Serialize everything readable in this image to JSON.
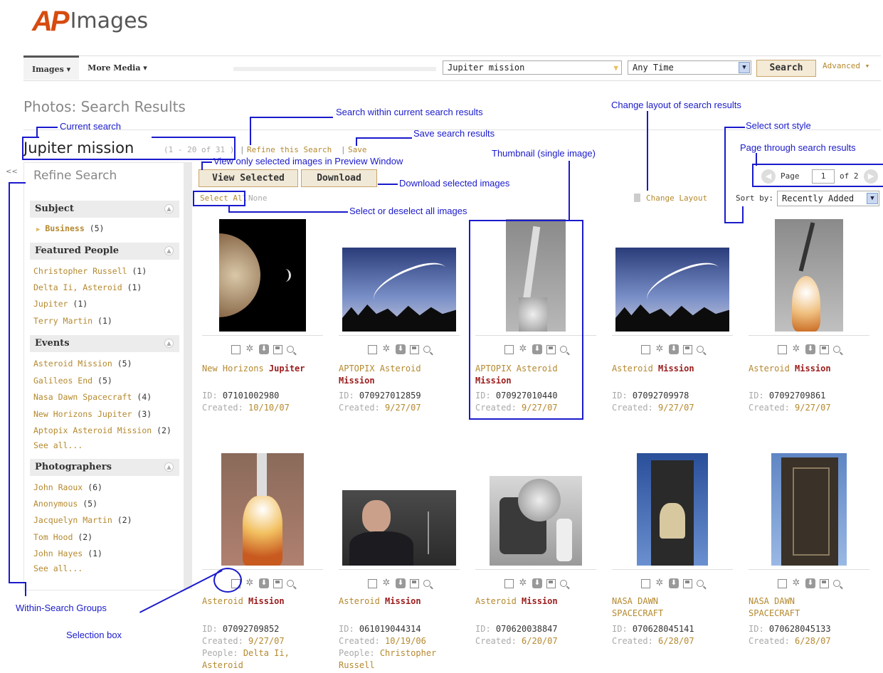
{
  "logo": {
    "ap": "AP",
    "images": "Images"
  },
  "nav": {
    "tabs": [
      "Images ▾",
      "More Media ▾"
    ],
    "search_value": "Jupiter mission",
    "time_value": "Any Time",
    "search_button": "Search",
    "advanced": "Advanced ▾"
  },
  "header": {
    "page_heading": "Photos: Search Results",
    "query": "Jupiter mission",
    "range": "(1 - 20 of 31 )",
    "refine_link": "Refine this Search",
    "save_link": "Save"
  },
  "sidebar": {
    "title": "Refine Search",
    "groups": [
      {
        "title": "Subject",
        "items": [
          {
            "label": "Business",
            "count": "(5)"
          }
        ]
      },
      {
        "title": "Featured People",
        "items": [
          {
            "label": "Christopher Russell",
            "count": "(1)"
          },
          {
            "label": "Delta Ii, Asteroid",
            "count": "(1)"
          },
          {
            "label": "Jupiter",
            "count": "(1)"
          },
          {
            "label": "Terry Martin",
            "count": "(1)"
          }
        ]
      },
      {
        "title": "Events",
        "items": [
          {
            "label": "Asteroid Mission",
            "count": "(5)"
          },
          {
            "label": "Galileos End",
            "count": "(5)"
          },
          {
            "label": "Nasa Dawn Spacecraft",
            "count": "(4)"
          },
          {
            "label": "New Horizons Jupiter",
            "count": "(3)"
          },
          {
            "label": "Aptopix Asteroid Mission",
            "count": "(2)"
          }
        ],
        "see_all": "See all..."
      },
      {
        "title": "Photographers",
        "items": [
          {
            "label": "John Raoux",
            "count": "(6)"
          },
          {
            "label": "Anonymous",
            "count": "(5)"
          },
          {
            "label": "Jacquelyn Martin",
            "count": "(2)"
          },
          {
            "label": "Tom Hood",
            "count": "(2)"
          },
          {
            "label": "John Hayes",
            "count": "(1)"
          }
        ],
        "see_all": "See all..."
      }
    ]
  },
  "toolbar": {
    "view_selected": "View Selected",
    "download": "Download",
    "select_all": "Select All",
    "none": "None",
    "change_layout": "Change Layout",
    "sort_label": "Sort by:",
    "sort_value": "Recently Added",
    "page_label": "Page",
    "page_value": "1",
    "page_of": "of 2"
  },
  "results": [
    {
      "title_a": "New Horizons ",
      "title_b": "Jupiter",
      "id_label": "ID:",
      "id": "07101002980",
      "created_label": "Created:",
      "created": "10/10/07"
    },
    {
      "title_a": "APTOPIX Asteroid",
      "title_b": "Mission",
      "id_label": "ID:",
      "id": "070927012859",
      "created_label": "Created:",
      "created": "9/27/07"
    },
    {
      "title_a": "APTOPIX Asteroid",
      "title_b": "Mission",
      "id_label": "ID:",
      "id": "070927010440",
      "created_label": "Created:",
      "created": "9/27/07"
    },
    {
      "title_a": "Asteroid ",
      "title_b": "Mission",
      "id_label": "ID:",
      "id": "07092709978",
      "created_label": "Created:",
      "created": "9/27/07"
    },
    {
      "title_a": "Asteroid ",
      "title_b": "Mission",
      "id_label": "ID:",
      "id": "07092709861",
      "created_label": "Created:",
      "created": "9/27/07"
    },
    {
      "title_a": "Asteroid ",
      "title_b": "Mission",
      "id_label": "ID:",
      "id": "07092709852",
      "created_label": "Created:",
      "created": "9/27/07",
      "people_label": "People:",
      "people": "Delta Ii, Asteroid"
    },
    {
      "title_a": "Asteroid ",
      "title_b": "Mission",
      "id_label": "ID:",
      "id": "061019044314",
      "created_label": "Created:",
      "created": "10/19/06",
      "people_label": "People:",
      "people": "Christopher Russell"
    },
    {
      "title_a": "Asteroid ",
      "title_b": "Mission",
      "id_label": "ID:",
      "id": "070620038847",
      "created_label": "Created:",
      "created": "6/20/07"
    },
    {
      "title_a": "NASA DAWN SPACECRAFT",
      "title_b": "",
      "id_label": "ID:",
      "id": "070628045141",
      "created_label": "Created:",
      "created": "6/28/07"
    },
    {
      "title_a": "NASA DAWN SPACECRAFT",
      "title_b": "",
      "id_label": "ID:",
      "id": "070628045133",
      "created_label": "Created:",
      "created": "6/28/07"
    }
  ],
  "annotations": {
    "search_within": "Search within current search results",
    "current_search": "Current search",
    "save_results": "Save search results",
    "change_layout": "Change layout of search results",
    "select_sort": "Select sort style",
    "page_through": "Page through search results",
    "thumbnail": "Thumbnail (single image)",
    "view_only": "View only selected images in Preview Window",
    "download_selected": "Download selected images",
    "select_deselect": "Select or deselect all images",
    "within_groups": "Within-Search Groups",
    "selection_box": "Selection box"
  },
  "colors": {
    "accent": "#b5892f",
    "highlight": "#9b1c1c",
    "annotation": "#1a1acc",
    "logo": "#d64b0f"
  }
}
